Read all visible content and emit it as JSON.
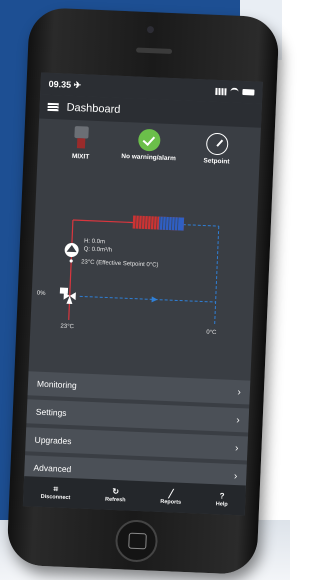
{
  "status_bar": {
    "time": "09.35 ✈"
  },
  "nav": {
    "title": "Dashboard"
  },
  "status_items": [
    {
      "label": "MIXIT",
      "icon": "mixit-device-icon"
    },
    {
      "label": "No warning/alarm",
      "icon": "check-circle-icon"
    },
    {
      "label": "Setpoint",
      "icon": "gauge-icon"
    }
  ],
  "diagram": {
    "flow_h": "H: 0.0m",
    "flow_q": "Q: 0.0m³/h",
    "setpoint": "23°C (Effective Setpoint 0°C)",
    "valve": "0%",
    "supply_temp": "23°C",
    "return_temp": "0°C"
  },
  "menu": [
    {
      "label": "Monitoring"
    },
    {
      "label": "Settings"
    },
    {
      "label": "Upgrades"
    },
    {
      "label": "Advanced"
    }
  ],
  "tabs": [
    {
      "label": "Disconnect",
      "icon": "disconnect-icon"
    },
    {
      "label": "Refresh",
      "icon": "refresh-icon"
    },
    {
      "label": "Reports",
      "icon": "reports-icon"
    },
    {
      "label": "Help",
      "icon": "help-icon"
    }
  ],
  "colors": {
    "ok": "#6bbf4a",
    "supply_line": "#d9363e",
    "return_line": "#2f7fd6",
    "menu_bg": "#4b5057"
  }
}
